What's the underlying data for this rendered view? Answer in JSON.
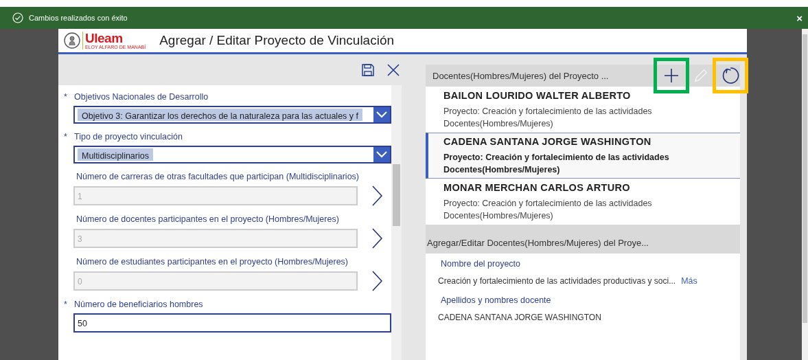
{
  "notification": {
    "message": "Cambios realizados con éxito",
    "close": "×"
  },
  "app": {
    "logo_text": "Uleam",
    "logo_subtitle": "ELOY ALFARO DE MANABÍ",
    "title": "Agregar / Editar Proyecto de Vinculación"
  },
  "form": {
    "fields": [
      {
        "kind": "dropdown",
        "label": "Objetivos Nacionales de Desarrollo",
        "required_mark": "*",
        "value": "Objetivo 3: Garantizar los derechos de la naturaleza para las actuales y f"
      },
      {
        "kind": "dropdown",
        "label": "Tipo de proyecto vinculación",
        "required_mark": "*",
        "value": "Multidisciplinarios"
      },
      {
        "kind": "linked",
        "label": "Número de carreras de otras facultades que  participan (Multidisciplinarios)",
        "disabled": true,
        "value": "1"
      },
      {
        "kind": "linked",
        "label": "Número de docentes participantes en el proyecto (Hombres/Mujeres)",
        "disabled": true,
        "value": "3"
      },
      {
        "kind": "linked",
        "label": "Número de estudiantes participantes en el proyecto (Hombres/Mujeres)",
        "disabled": true,
        "value": "0"
      },
      {
        "kind": "text",
        "label": "Número de beneficiarios hombres",
        "required_mark": "*",
        "value": "50"
      }
    ]
  },
  "teachers": {
    "title": "Docentes(Hombres/Mujeres) del Proyecto ...",
    "toolbar": [
      {
        "kind": "add",
        "disabled": false,
        "color": "#00b050"
      },
      {
        "kind": "edit",
        "disabled": true
      },
      {
        "kind": "refresh",
        "disabled": false,
        "color": "#ffc000"
      }
    ],
    "items": [
      {
        "name": "BAILON LOURIDO WALTER ALBERTO",
        "project": "Proyecto: Creación y fortalecimiento de las actividades",
        "type": "Docentes(Hombres/Mujeres)",
        "selected": false
      },
      {
        "name": "CADENA SANTANA JORGE WASHINGTON",
        "project": "Proyecto: Creación y fortalecimiento de las actividades",
        "type": "Docentes(Hombres/Mujeres)",
        "selected": true
      },
      {
        "name": "MONAR MERCHAN CARLOS ARTURO",
        "project": "Proyecto: Creación y fortalecimiento de las actividades",
        "type": "Docentes(Hombres/Mujeres)",
        "selected": false
      }
    ]
  },
  "detail": {
    "title": "Agregar/Editar Docentes(Hombres/Mujeres) del Proye...",
    "fields": [
      {
        "label": "Nombre del proyecto",
        "value": "Creación y fortalecimiento de las actividades productivas y soci...",
        "more": "Más"
      },
      {
        "label": "Apellidos y nombres docente",
        "value": "CADENA SANTANA JORGE WASHINGTON"
      }
    ]
  }
}
